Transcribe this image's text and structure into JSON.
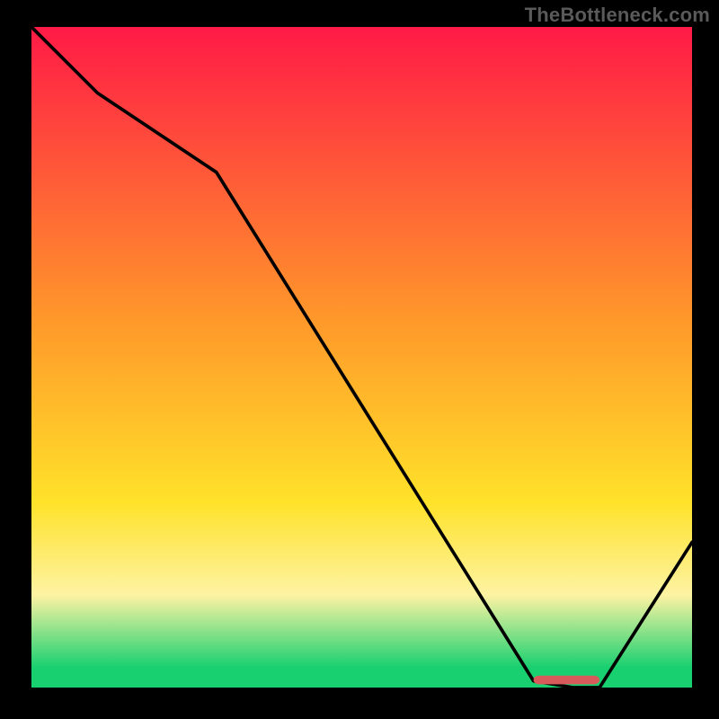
{
  "watermark": "TheBottleneck.com",
  "colors": {
    "red": "#ff1a46",
    "orange": "#ff9a2a",
    "yellow": "#ffe22a",
    "paleyellow": "#fdf3a3",
    "green": "#18d070",
    "curve": "#000000",
    "marker": "#d85a5a",
    "bg": "#000000"
  },
  "chart_data": {
    "type": "line",
    "title": "",
    "xlabel": "",
    "ylabel": "",
    "xlim": [
      0,
      100
    ],
    "ylim": [
      0,
      100
    ],
    "series": [
      {
        "name": "bottleneck-curve",
        "x": [
          0,
          10,
          28,
          76,
          82,
          86,
          100
        ],
        "y": [
          100,
          90,
          78,
          1,
          0,
          0,
          22
        ]
      }
    ],
    "marker": {
      "name": "optimal-range",
      "x_start": 76,
      "x_end": 86,
      "y": 0.5
    },
    "gradient_stops": [
      {
        "pct": 0,
        "color": "#ff1a46"
      },
      {
        "pct": 45,
        "color": "#ff9a2a"
      },
      {
        "pct": 72,
        "color": "#ffe22a"
      },
      {
        "pct": 86,
        "color": "#fdf3a3"
      },
      {
        "pct": 97,
        "color": "#18d070"
      },
      {
        "pct": 100,
        "color": "#18d070"
      }
    ]
  }
}
